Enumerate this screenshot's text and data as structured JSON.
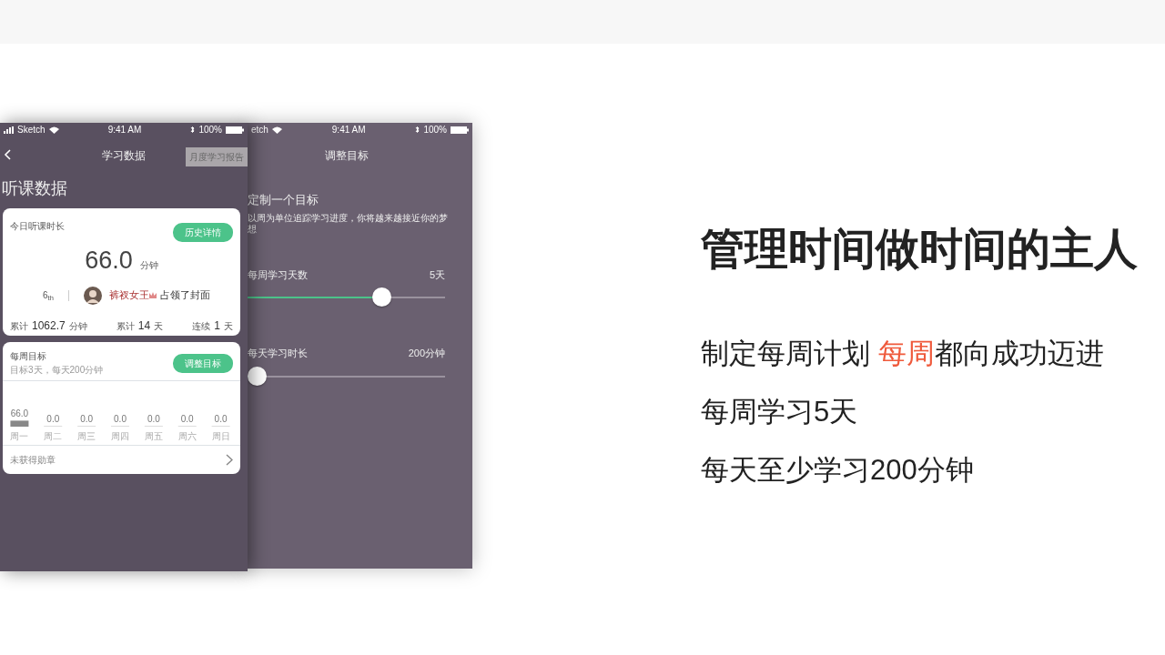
{
  "data_screen": {
    "status": {
      "carrier": "Sketch",
      "time": "9:41 AM",
      "battery": "100%"
    },
    "nav": {
      "title": "学习数据",
      "action": "月度学习报告"
    },
    "heading": "听课数据",
    "today_card": {
      "label": "今日听课时长",
      "button": "历史详情",
      "value": "66.0",
      "unit": "分钟",
      "rank": "6$_{th}$",
      "user": "裤衩女王",
      "message": "占领了封面",
      "stats": [
        {
          "label": "累计",
          "value": "1062.7",
          "unit": "分钟"
        },
        {
          "label": "累计",
          "value": "14",
          "unit": "天"
        },
        {
          "label": "连续",
          "value": "1",
          "unit": "天"
        }
      ]
    },
    "goal_card": {
      "title": "每周目标",
      "subtitle": "目标3天，每天200分钟",
      "button": "调整目标",
      "chart_data": {
        "type": "bar",
        "categories": [
          "周一",
          "周二",
          "周三",
          "周四",
          "周五",
          "周六",
          "周日"
        ],
        "values": [
          66.0,
          0.0,
          0.0,
          0.0,
          0.0,
          0.0,
          0.0
        ],
        "value_labels": [
          "66.0",
          "0.0",
          "0.0",
          "0.0",
          "0.0",
          "0.0",
          "0.0"
        ]
      },
      "footer": "未获得勋章"
    }
  },
  "goal_screen": {
    "status": {
      "carrier": "etch",
      "time": "9:41 AM",
      "battery": "100%"
    },
    "title": "调整目标",
    "heading": "定制一个目标",
    "description": "以周为单位追踪学习进度，你将越来越接近你的梦想",
    "settings": [
      {
        "label": "每周学习天数",
        "reading": "5天",
        "level": 0.7
      },
      {
        "label": "每天学习时长",
        "reading": "200分钟",
        "level": 0
      }
    ]
  },
  "slide": {
    "title": "管理时间做时间的主人",
    "lines": [
      {
        "segments": [
          {
            "text": "制定每周计划 ",
            "highlight": false
          },
          {
            "text": "每周",
            "highlight": true
          },
          {
            "text": "都向成功迈进",
            "highlight": false
          }
        ]
      },
      {
        "segments": [
          {
            "text": "每周学习5天",
            "highlight": false
          }
        ]
      },
      {
        "segments": [
          {
            "text": "每天至少学习200分钟",
            "highlight": false
          }
        ]
      }
    ]
  }
}
